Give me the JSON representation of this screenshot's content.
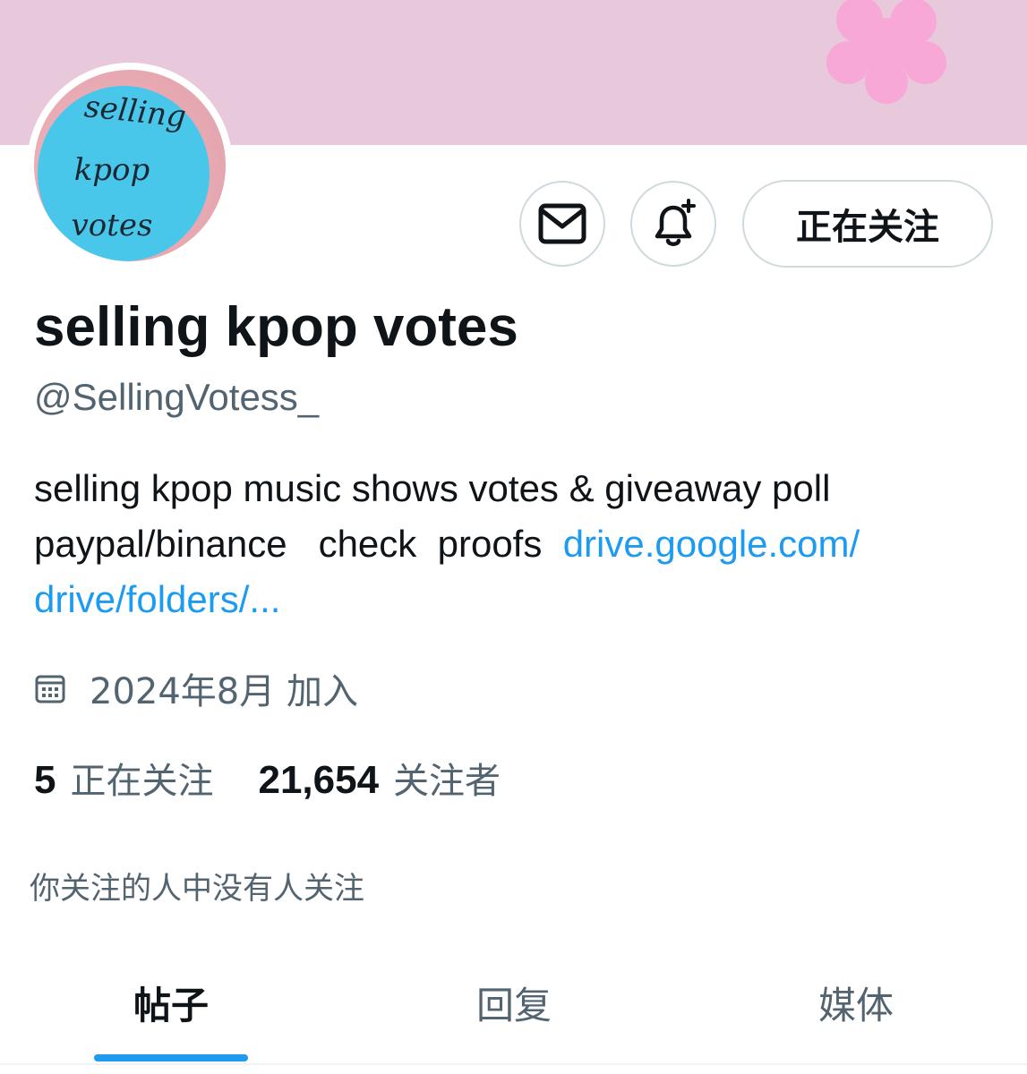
{
  "profile": {
    "display_name": "selling kpop votes",
    "handle": "@SellingVotess_",
    "avatar_text": [
      "selling",
      "kpop",
      "votes"
    ],
    "bio_line1": "selling kpop music shows votes & giveaway poll",
    "bio_line2_text": "paypal/binance   check  proofs  ",
    "bio_link_part1": "drive.google.com/",
    "bio_link_part2": "drive/folders/...",
    "joined": "2024年8月 加入",
    "following_count": "5",
    "following_label": "正在关注",
    "followers_count": "21,654",
    "followers_label": "关注者",
    "mutual_note": "你关注的人中没有人关注"
  },
  "actions": {
    "message_icon": "envelope-icon",
    "notify_icon": "bell-plus-icon",
    "follow_label": "正在关注"
  },
  "tabs": [
    {
      "label": "帖子",
      "active": true
    },
    {
      "label": "回复",
      "active": false
    },
    {
      "label": "媒体",
      "active": false
    }
  ],
  "colors": {
    "banner": "#e8c9dc",
    "accent": "#1d9bf0",
    "avatar_blue": "#49c7ea",
    "flower": "#f7a8d6"
  }
}
